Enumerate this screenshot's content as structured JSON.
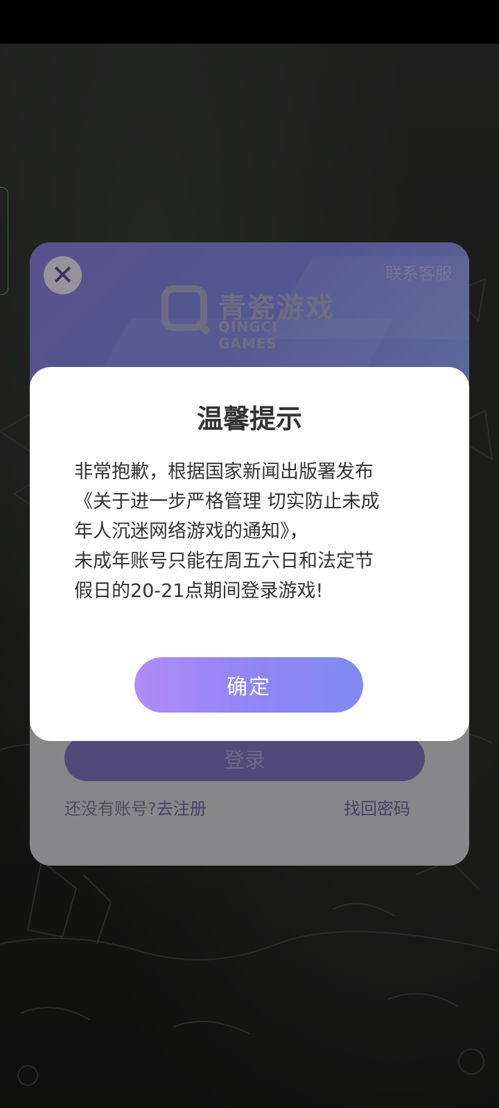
{
  "login": {
    "contact_label": "联系客服",
    "brand_name": "青瓷游戏",
    "brand_sub": "QINGCI GAMES",
    "login_label": "登录",
    "no_account": "还没有账号?",
    "register_label": "去注册",
    "forgot_label": "找回密码"
  },
  "dialog": {
    "title": "温馨提示",
    "lines": [
      "非常抱歉，根据国家新闻出版署发布",
      "《关于进一步严格管理 切实防止未成",
      "年人沉迷网络游戏的通知》，",
      "未成年账号只能在周五六日和法定节",
      "假日的20-21点期间登录游戏!"
    ],
    "confirm_label": "确定"
  }
}
